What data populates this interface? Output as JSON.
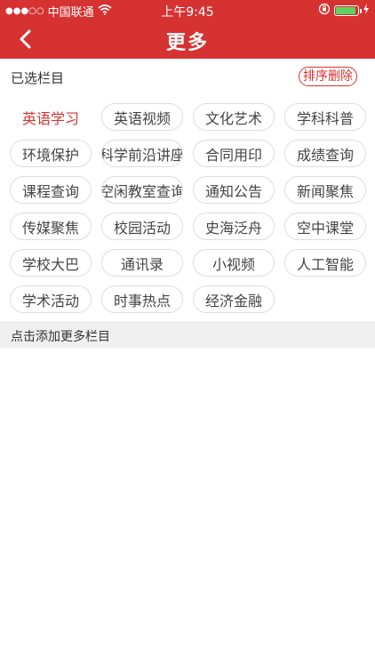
{
  "status_bar": {
    "signal": "●●●○○",
    "carrier": "中国联通",
    "time": "上午9:45"
  },
  "nav": {
    "title": "更多"
  },
  "selected": {
    "title": "已选栏目",
    "sort_delete_label": "排序删除",
    "items": [
      {
        "label": "英语学习",
        "active": true
      },
      {
        "label": "英语视频"
      },
      {
        "label": "文化艺术"
      },
      {
        "label": "学科科普"
      },
      {
        "label": "环境保护"
      },
      {
        "label": "科学前沿讲座"
      },
      {
        "label": "合同用印"
      },
      {
        "label": "成绩查询"
      },
      {
        "label": "课程查询"
      },
      {
        "label": "空闲教室查询"
      },
      {
        "label": "通知公告"
      },
      {
        "label": "新闻聚焦"
      },
      {
        "label": "传媒聚焦"
      },
      {
        "label": "校园活动"
      },
      {
        "label": "史海泛舟"
      },
      {
        "label": "空中课堂"
      },
      {
        "label": "学校大巴"
      },
      {
        "label": "通讯录"
      },
      {
        "label": "小视频"
      },
      {
        "label": "人工智能"
      },
      {
        "label": "学术活动"
      },
      {
        "label": "时事热点"
      },
      {
        "label": "经济金融"
      }
    ]
  },
  "more": {
    "title": "点击添加更多栏目"
  },
  "colors": {
    "brand": "#d63232",
    "chip_border": "#dddddd",
    "section_bg": "#efefef",
    "battery": "#5fd35f"
  }
}
